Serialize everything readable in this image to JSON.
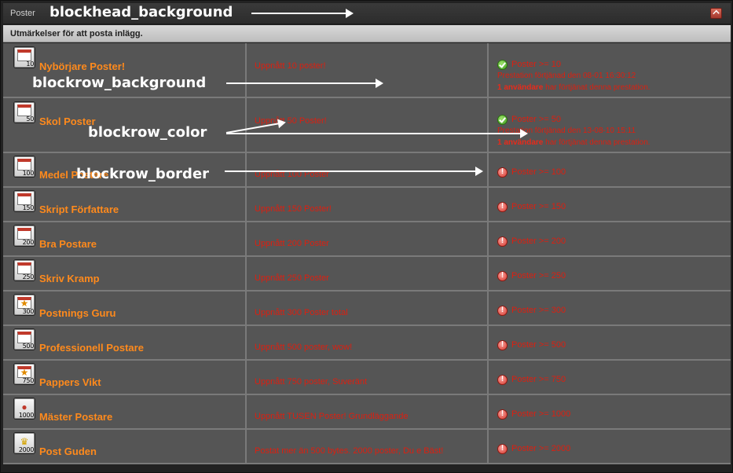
{
  "block": {
    "title": "Poster",
    "subtitle": "Utmärkelser för att posta inlägg."
  },
  "colors": {
    "head_bg": "#2e2e2e",
    "subhead_bg": "#cbcbcb",
    "row_bg": "#555555",
    "row_border": "#7a7a7a",
    "award_name": "#ff8a1c",
    "requirement_text": "#dd1f10",
    "ok_icon": "#4aa82a",
    "warn_icon": "#d8392f"
  },
  "awards": [
    {
      "name": "Nybörjare Poster!",
      "badge_number": "10",
      "badge_icon": "calendar-icon",
      "requirement": "Uppnått 10 poster!",
      "status": "ok",
      "status_icon": "check-circle-icon",
      "status_text": "Poster >= 10",
      "detail_line1": "Prestation förtjänad den 08-01 16:30:12",
      "detail_count": "1 användare",
      "detail_rest": " har förtjänat denna prestation."
    },
    {
      "name": "Skol Poster",
      "badge_number": "50",
      "badge_icon": "calendar-icon",
      "requirement": "Uppnått 50 Poster!",
      "status": "ok",
      "status_icon": "check-circle-icon",
      "status_text": "Poster >= 50",
      "detail_line1": "Prestation förtjänad den 13-08-10 15:11",
      "detail_count": "1 användare",
      "detail_rest": " har förtjänat denna prestation."
    },
    {
      "name": "Medel Postare",
      "badge_number": "100",
      "badge_icon": "calendar-icon",
      "requirement": "Uppnått 100 Poster",
      "status": "warn",
      "status_icon": "exclamation-circle-icon",
      "status_text": "Poster >= 100"
    },
    {
      "name": "Skript Författare",
      "badge_number": "150",
      "badge_icon": "calendar-icon",
      "requirement": "Uppnått 150 Poster!",
      "status": "warn",
      "status_icon": "exclamation-circle-icon",
      "status_text": "Poster >= 150"
    },
    {
      "name": "Bra Postare",
      "badge_number": "200",
      "badge_icon": "calendar-icon",
      "requirement": "Uppnått 200 Poster",
      "status": "warn",
      "status_icon": "exclamation-circle-icon",
      "status_text": "Poster >= 200"
    },
    {
      "name": "Skriv Kramp",
      "badge_number": "250",
      "badge_icon": "calendar-icon",
      "requirement": "Uppnått 250 Poster",
      "status": "warn",
      "status_icon": "exclamation-circle-icon",
      "status_text": "Poster >= 250"
    },
    {
      "name": "Postnings Guru",
      "badge_number": "300",
      "badge_icon": "star-calendar-icon",
      "requirement": "Uppnått 300 Poster total",
      "status": "warn",
      "status_icon": "exclamation-circle-icon",
      "status_text": "Poster >= 300"
    },
    {
      "name": "Professionell Postare",
      "badge_number": "500",
      "badge_icon": "calendar-icon",
      "requirement": "Uppnått 500 poster, wow!",
      "status": "warn",
      "status_icon": "exclamation-circle-icon",
      "status_text": "Poster >= 500"
    },
    {
      "name": "Pappers Vikt",
      "badge_number": "750",
      "badge_icon": "star-calendar-icon",
      "requirement": "Uppnått 750 poster, Suveränt",
      "status": "warn",
      "status_icon": "exclamation-circle-icon",
      "status_text": "Poster >= 750"
    },
    {
      "name": "Mäster Postare",
      "badge_number": "1000",
      "badge_icon": "medal-icon",
      "requirement": "Uppnått TUSEN Poster! Grundläggande",
      "status": "warn",
      "status_icon": "exclamation-circle-icon",
      "status_text": "Poster >= 1000"
    },
    {
      "name": "Post Guden",
      "badge_number": "2000",
      "badge_icon": "trophy-icon",
      "requirement": "Postat mer än 500 bytes. 2000 poster, Du e Bäst!",
      "status": "warn",
      "status_icon": "exclamation-circle-icon",
      "status_text": "Poster >= 2000"
    }
  ],
  "annotations": {
    "blockhead": "blockhead_background",
    "blockrow_bg": "blockrow_background",
    "blockrow_color": "blockrow_color",
    "blockrow_border": "blockrow_border"
  }
}
